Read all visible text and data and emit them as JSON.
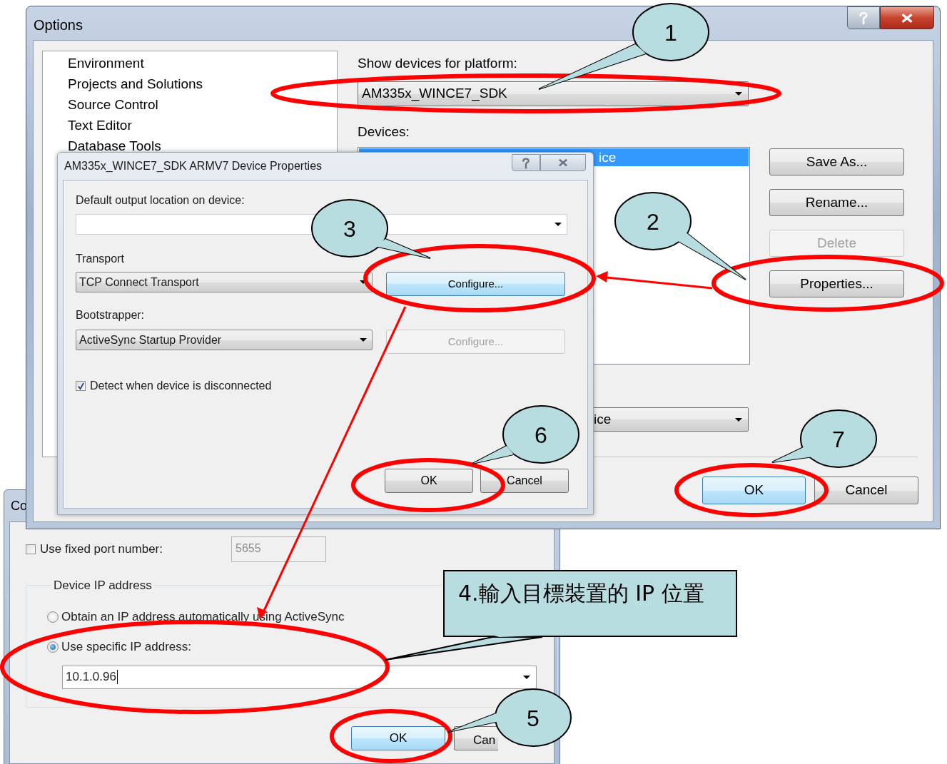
{
  "options_window": {
    "title": "Options",
    "nav_items": [
      {
        "label": "Environment"
      },
      {
        "label": "Projects and Solutions"
      },
      {
        "label": "Source Control"
      },
      {
        "label": "Text Editor"
      },
      {
        "label": "Database Tools"
      }
    ],
    "platform_label": "Show devices for platform:",
    "platform_value": "AM335x_WINCE7_SDK",
    "devices_label": "Devices:",
    "devices": [
      {
        "label": "ice",
        "selected": true
      }
    ],
    "side_buttons": [
      {
        "label": "Save As...",
        "disabled": false
      },
      {
        "label": "Rename...",
        "disabled": false
      },
      {
        "label": "Delete",
        "disabled": true
      },
      {
        "label": "Properties...",
        "disabled": false
      }
    ],
    "default_device_value": "ice",
    "buttons": [
      {
        "label": "OK",
        "default": true
      },
      {
        "label": "Cancel",
        "default": false
      }
    ]
  },
  "properties_dialog": {
    "title": "AM335x_WINCE7_SDK ARMV7 Device Properties",
    "output_label": "Default output location on device:",
    "transport_label": "Transport",
    "transport_value": "TCP Connect Transport",
    "bootstrapper_label": "Bootstrapper:",
    "bootstrapper_value": "ActiveSync Startup Provider",
    "configure_buttons": [
      {
        "label": "Configure...",
        "disabled": false
      },
      {
        "label": "Configure...",
        "disabled": true
      }
    ],
    "detect_disconnect": {
      "label": "Detect when device is disconnected",
      "checked": true
    },
    "buttons": [
      {
        "label": "OK",
        "default": false
      },
      {
        "label": "Cancel",
        "default": false
      }
    ]
  },
  "configure_dialog": {
    "title": "Co",
    "fixed_port": {
      "label": "Use fixed port number:",
      "checked": false,
      "value": "5655"
    },
    "group_label": "Device IP address",
    "ip_options": [
      {
        "label": "Obtain an IP address automatically using ActiveSync",
        "selected": false
      },
      {
        "label": "Use specific IP address:",
        "selected": true
      }
    ],
    "ip_value": "10.1.0.96",
    "buttons": [
      {
        "label": "OK",
        "default": true
      },
      {
        "label": "Can",
        "default": false
      }
    ]
  },
  "annotations": {
    "callouts": [
      {
        "number": "1"
      },
      {
        "number": "2"
      },
      {
        "number": "3"
      },
      {
        "number": "5"
      },
      {
        "number": "6"
      },
      {
        "number": "7"
      }
    ],
    "note": "4.輸入目標裝置的 IP 位置"
  }
}
